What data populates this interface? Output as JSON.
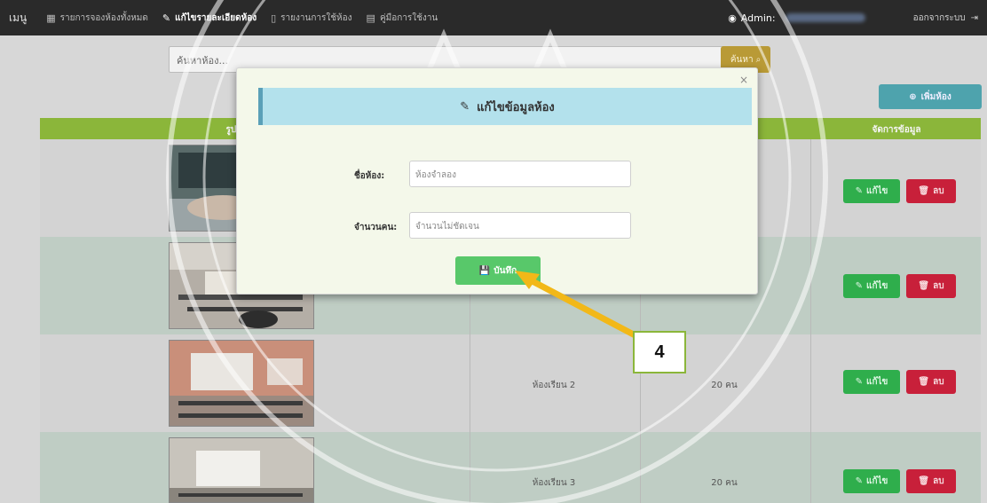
{
  "navbar": {
    "brand": "เมนู",
    "items": [
      {
        "icon": "list-icon",
        "glyph": "▦",
        "label": "รายการจองห้องทั้งหมด",
        "active": false
      },
      {
        "icon": "edit-icon",
        "glyph": "✎",
        "label": "แก้ไขรายละเอียดห้อง",
        "active": true
      },
      {
        "icon": "file-icon",
        "glyph": "🗋",
        "label": "รายงานการใช้ห้อง",
        "active": false
      },
      {
        "icon": "book-icon",
        "glyph": "▤",
        "label": "คู่มือการใช้งาน",
        "active": false
      }
    ],
    "admin_label": "Admin:",
    "logout_label": "ออกจากระบบ"
  },
  "search": {
    "placeholder": "ค้นหาห้อง...",
    "button_label": "ค้นหา"
  },
  "add_room_label": "เพิ่มห้อง",
  "table": {
    "headers": [
      "รูปภาพ",
      "จัดการข้อมูล"
    ],
    "rows": [
      {
        "name": "",
        "capacity": ""
      },
      {
        "name": "",
        "capacity": ""
      },
      {
        "name": "ห้องเรียน 2",
        "capacity": "20 คน"
      },
      {
        "name": "ห้องเรียน 3",
        "capacity": "20 คน"
      }
    ],
    "edit_label": "แก้ไข",
    "delete_label": "ลบ"
  },
  "modal": {
    "title": "แก้ไขข้อมูลห้อง",
    "close": "×",
    "room_name_label": "ชื่อห้อง:",
    "room_name_value": "ห้องจำลอง",
    "capacity_label": "จำนวนคน:",
    "capacity_value": "จำนวนไม่ชัดเจน",
    "save_label": "บันทึก"
  },
  "callout": {
    "number": "4"
  },
  "colors": {
    "navbar": "#2a2a2a",
    "table_header": "#8bb63a",
    "edit": "#2fae4c",
    "delete": "#c8203a",
    "save": "#58c86a",
    "modal_header": "#b3e1ec",
    "arrow": "#f2b818"
  }
}
